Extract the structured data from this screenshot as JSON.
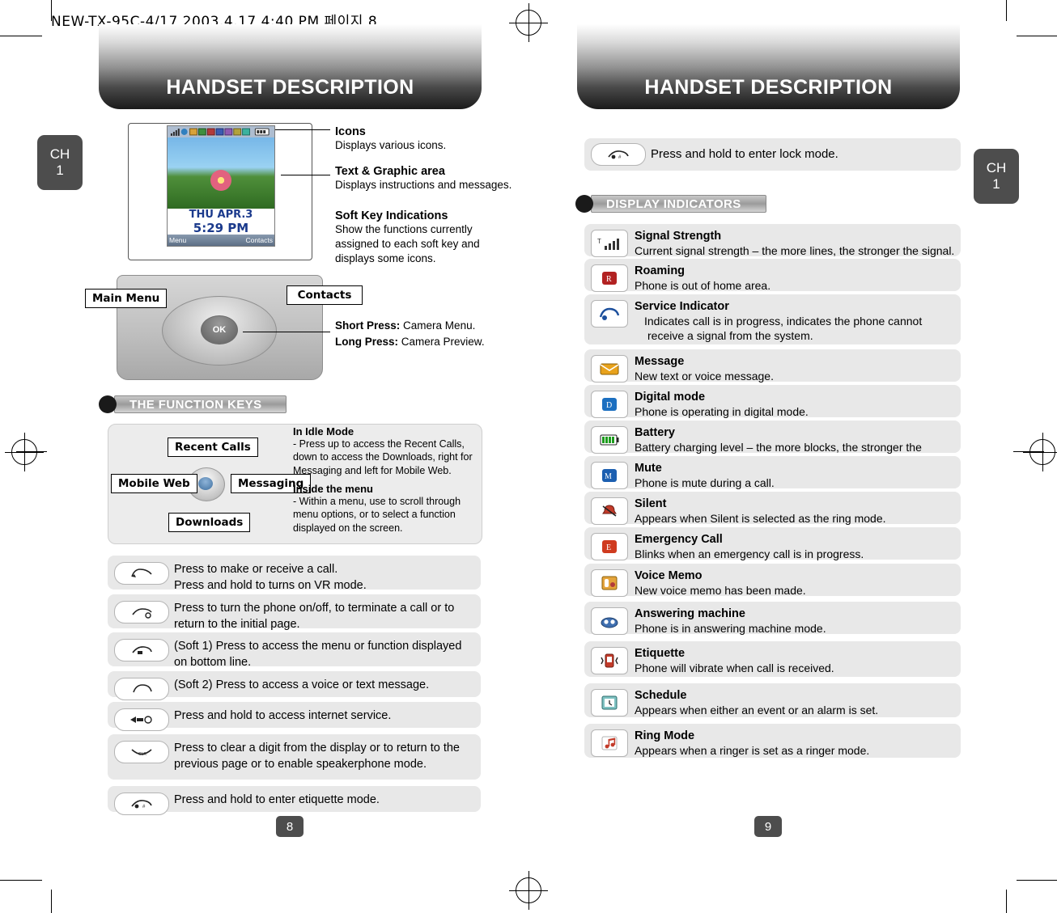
{
  "slug": "NEW-TX-95C-4/17  2003.4.17 4:40 PM 페이지 8",
  "left_page": {
    "header": "HANDSET DESCRIPTION",
    "chapter_tab": {
      "line1": "CH",
      "line2": "1"
    },
    "page_number": "8",
    "callouts": [
      {
        "title": "Icons",
        "body": "Displays various icons."
      },
      {
        "title": "Text & Graphic area",
        "body": "Displays instructions and messages."
      },
      {
        "title": "Soft Key Indications",
        "body": "Show the functions currently assigned to each soft key and displays some icons."
      }
    ],
    "press_notes": [
      {
        "label": "Short Press:",
        "value": "Camera Menu."
      },
      {
        "label": "Long Press:",
        "value": "Camera Preview."
      }
    ],
    "phone_labels": {
      "main_menu": "Main Menu",
      "contacts": "Contacts"
    },
    "lcd": {
      "date": "THU APR.3",
      "time": "5:29 PM",
      "soft_left": "Menu",
      "soft_right": "Contacts"
    },
    "function_keys_title": "THE FUNCTION KEYS",
    "diagram_labels": {
      "recent_calls": "Recent Calls",
      "mobile_web": "Mobile Web",
      "messaging": "Messaging",
      "downloads": "Downloads"
    },
    "diagram_notes": [
      {
        "title": "In Idle Mode",
        "body": "- Press up to access the Recent Calls, down to access the Downloads, right for Messaging and left for Mobile Web."
      },
      {
        "title": "Inside the menu",
        "body": "- Within a menu, use to scroll through menu options, or to select a function displayed on the screen."
      }
    ],
    "key_rows": [
      {
        "icon": "send-key-icon",
        "text": "Press to make or receive a call.\nPress and hold to turns on VR mode."
      },
      {
        "icon": "power-end-key-icon",
        "text": "Press to turn the phone on/off, to terminate a call or to return to the initial page."
      },
      {
        "icon": "soft-key-1-icon",
        "text": "(Soft 1) Press to access the menu or function displayed on bottom line."
      },
      {
        "icon": "soft-key-2-icon",
        "text": "(Soft 2) Press to access a voice or text message."
      },
      {
        "icon": "internet-key-icon",
        "text": "Press and hold to access internet service."
      },
      {
        "icon": "clear-key-icon",
        "text": "Press to clear a digit from the display or to return to the previous page or to enable speakerphone mode."
      },
      {
        "icon": "etiquette-key-icon",
        "text": "Press and hold to enter etiquette mode."
      }
    ]
  },
  "right_page": {
    "header": "HANDSET DESCRIPTION",
    "chapter_tab": {
      "line1": "CH",
      "line2": "1"
    },
    "page_number": "9",
    "lock_row": {
      "icon": "lock-key-icon",
      "text": "Press and hold to enter lock mode."
    },
    "indicators_title": "DISPLAY INDICATORS",
    "indicators": [
      {
        "icon": "signal-strength-icon",
        "title": "Signal Strength",
        "desc": "Current signal strength – the more lines, the stronger the signal."
      },
      {
        "icon": "roaming-icon",
        "title": "Roaming",
        "desc": "Phone is out of home area."
      },
      {
        "icon": "service-indicator-icon",
        "title": "Service Indicator",
        "desc": "Indicates call is in progress,  indicates the phone cannot receive a signal from the system."
      },
      {
        "icon": "message-icon",
        "title": "Message",
        "desc": "New text or voice message."
      },
      {
        "icon": "digital-mode-icon",
        "title": "Digital mode",
        "desc": "Phone is operating in digital mode."
      },
      {
        "icon": "battery-icon",
        "title": "Battery",
        "desc": "Battery charging level – the more blocks, the stronger the charge."
      },
      {
        "icon": "mute-icon",
        "title": "Mute",
        "desc": "Phone is mute during a call."
      },
      {
        "icon": "silent-icon",
        "title": "Silent",
        "desc": "Appears when Silent is selected as the ring mode."
      },
      {
        "icon": "emergency-call-icon",
        "title": "Emergency Call",
        "desc": "Blinks when an emergency call is in progress."
      },
      {
        "icon": "voice-memo-icon",
        "title": "Voice Memo",
        "desc": "New voice memo has been made."
      },
      {
        "icon": "answering-machine-icon",
        "title": "Answering machine",
        "desc": "Phone is in answering machine mode."
      },
      {
        "icon": "etiquette-icon",
        "title": "Etiquette",
        "desc": "Phone will vibrate when call is received."
      },
      {
        "icon": "schedule-icon",
        "title": "Schedule",
        "desc": "Appears when either an event or an alarm is set."
      },
      {
        "icon": "ring-mode-icon",
        "title": "Ring Mode",
        "desc": "Appears when a ringer is set as a ringer mode."
      }
    ]
  }
}
